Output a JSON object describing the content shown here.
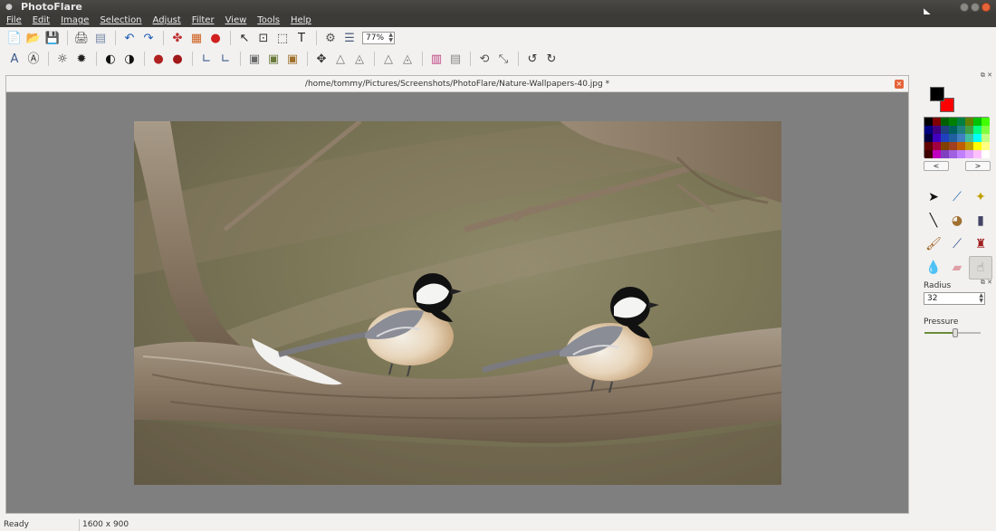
{
  "window": {
    "title": "PhotoFlare"
  },
  "menu": [
    "File",
    "Edit",
    "Image",
    "Selection",
    "Adjust",
    "Filter",
    "View",
    "Tools",
    "Help"
  ],
  "toolbar1": {
    "groups": [
      [
        {
          "name": "new-file-icon",
          "glyph": "📄",
          "color": "#6a9a3a"
        },
        {
          "name": "open-folder-icon",
          "glyph": "📂",
          "color": "#d8a020"
        },
        {
          "name": "save-icon",
          "glyph": "💾",
          "color": "#3a6aa8"
        }
      ],
      [
        {
          "name": "print-icon",
          "glyph": "🖨",
          "color": "#555"
        },
        {
          "name": "print-preview-icon",
          "glyph": "▤",
          "color": "#7a8aa8"
        }
      ],
      [
        {
          "name": "undo-icon",
          "glyph": "↶",
          "color": "#1a5ab0"
        },
        {
          "name": "redo-icon",
          "glyph": "↷",
          "color": "#1a5ab0"
        }
      ],
      [
        {
          "name": "color-picker-icon",
          "glyph": "✤",
          "color": "#c03030"
        },
        {
          "name": "palette-grid-icon",
          "glyph": "▦",
          "color": "#d06020"
        },
        {
          "name": "color-balance-icon",
          "glyph": "●",
          "color": "#d02020"
        }
      ],
      [
        {
          "name": "pointer-icon",
          "glyph": "↖",
          "color": "#222"
        },
        {
          "name": "crop-icon",
          "glyph": "⊡",
          "color": "#333"
        },
        {
          "name": "select-rect-icon",
          "glyph": "⬚",
          "color": "#333"
        },
        {
          "name": "text-tool-icon",
          "glyph": "T",
          "color": "#222"
        }
      ],
      [
        {
          "name": "settings-gear-icon",
          "glyph": "⚙",
          "color": "#555"
        },
        {
          "name": "layers-icon",
          "glyph": "☰",
          "color": "#4a5a7a"
        }
      ]
    ],
    "zoom": "77%"
  },
  "toolbar2": {
    "groups": [
      [
        {
          "name": "font-a-icon",
          "glyph": "𝖠",
          "color": "#3a5a8a"
        },
        {
          "name": "font-stylize-icon",
          "glyph": "Ⓐ",
          "color": "#333"
        }
      ],
      [
        {
          "name": "brightness-up-icon",
          "glyph": "☼",
          "color": "#222"
        },
        {
          "name": "brightness-down-icon",
          "glyph": "✹",
          "color": "#222"
        }
      ],
      [
        {
          "name": "contrast-icon",
          "glyph": "◐",
          "color": "#111"
        },
        {
          "name": "contrast-invert-icon",
          "glyph": "◑",
          "color": "#111"
        }
      ],
      [
        {
          "name": "red-eye-icon",
          "glyph": "●",
          "color": "#b02020"
        },
        {
          "name": "saturation-icon",
          "glyph": "●",
          "color": "#a01818"
        }
      ],
      [
        {
          "name": "rotate-left-angle-icon",
          "glyph": "∟",
          "color": "#3a5a8a"
        },
        {
          "name": "rotate-right-angle-icon",
          "glyph": "∟",
          "color": "#3a5a8a"
        }
      ],
      [
        {
          "name": "image-grayscale-icon",
          "glyph": "▣",
          "color": "#6a6a6a"
        },
        {
          "name": "image-filter-icon",
          "glyph": "▣",
          "color": "#6a7a3a"
        },
        {
          "name": "image-sepia-icon",
          "glyph": "▣",
          "color": "#a0702a"
        }
      ],
      [
        {
          "name": "move-icon",
          "glyph": "✥",
          "color": "#333"
        },
        {
          "name": "sharpen-icon",
          "glyph": "△",
          "color": "#777"
        },
        {
          "name": "blur-icon",
          "glyph": "◬",
          "color": "#777"
        }
      ],
      [
        {
          "name": "flip-horizontal-icon",
          "glyph": "△",
          "color": "#777"
        },
        {
          "name": "flip-vertical-icon",
          "glyph": "◬",
          "color": "#777"
        }
      ],
      [
        {
          "name": "gradient-color-icon",
          "glyph": "▥",
          "color": "#c04080"
        },
        {
          "name": "gradient-gray-icon",
          "glyph": "▤",
          "color": "#888"
        }
      ],
      [
        {
          "name": "rotate-free-icon",
          "glyph": "⟲",
          "color": "#555"
        },
        {
          "name": "transform-icon",
          "glyph": "⤡",
          "color": "#555"
        }
      ],
      [
        {
          "name": "rotate-ccw-icon",
          "glyph": "↺",
          "color": "#333"
        },
        {
          "name": "rotate-cw-icon",
          "glyph": "↻",
          "color": "#333"
        }
      ]
    ]
  },
  "document": {
    "title": "/home/tommy/Pictures/Screenshots/PhotoFlare/Nature-Wallpapers-40.jpg *"
  },
  "palette": {
    "foreground": "#000000",
    "background": "#ff0000",
    "colors": [
      "#000000",
      "#800000",
      "#006000",
      "#008000",
      "#008040",
      "#608000",
      "#00c000",
      "#40ff00",
      "#000080",
      "#400080",
      "#204080",
      "#006060",
      "#208080",
      "#40a040",
      "#00ff80",
      "#80ff40",
      "#000040",
      "#4000c0",
      "#2040c0",
      "#2060a0",
      "#4080c0",
      "#40c0a0",
      "#00ffff",
      "#c0ff80",
      "#600000",
      "#a00040",
      "#804000",
      "#a04020",
      "#c06000",
      "#c0a000",
      "#ffff00",
      "#ffff80",
      "#400000",
      "#c000c0",
      "#8040c0",
      "#a060e0",
      "#c080ff",
      "#e0a0ff",
      "#ffc0ff",
      "#ffffff"
    ],
    "prev_label": "<",
    "next_label": ">"
  },
  "tools": [
    {
      "name": "pointer-tool-icon",
      "glyph": "➤",
      "color": "#111"
    },
    {
      "name": "eyedropper-icon",
      "glyph": "⟋",
      "color": "#2a6ab0"
    },
    {
      "name": "magic-wand-icon",
      "glyph": "✦",
      "color": "#c0a000"
    },
    {
      "name": "line-tool-icon",
      "glyph": "╲",
      "color": "#111"
    },
    {
      "name": "paint-bucket-icon",
      "glyph": "◕",
      "color": "#a07030"
    },
    {
      "name": "spray-can-icon",
      "glyph": "▮",
      "color": "#446"
    },
    {
      "name": "paintbrush-icon",
      "glyph": "🖌",
      "color": "#a06020"
    },
    {
      "name": "clone-brush-icon",
      "glyph": "⟋",
      "color": "#2a4a8a"
    },
    {
      "name": "stamp-icon",
      "glyph": "♜",
      "color": "#a02020"
    },
    {
      "name": "blur-drop-icon",
      "glyph": "💧",
      "color": "#4aa0d0"
    },
    {
      "name": "eraser-icon",
      "glyph": "▰",
      "color": "#e0a0a8"
    },
    {
      "name": "smudge-icon",
      "glyph": "☝",
      "color": "#888"
    }
  ],
  "brush": {
    "radius_label": "Radius",
    "radius_value": "32",
    "pressure_label": "Pressure",
    "pressure": 0.55
  },
  "status": {
    "state": "Ready",
    "dimensions": "1600 x 900"
  }
}
